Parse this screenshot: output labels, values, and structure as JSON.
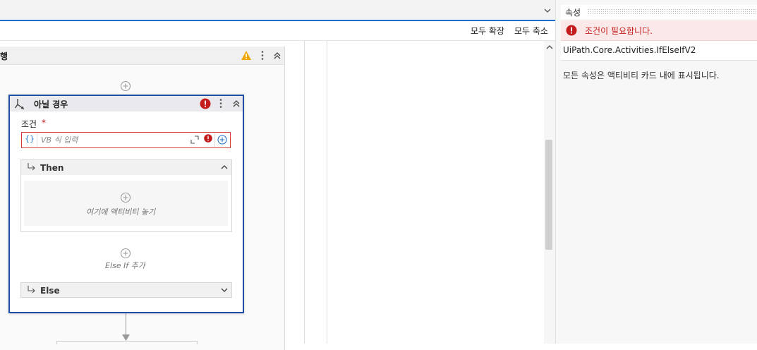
{
  "toolbar": {
    "expand_all": "모두 확장",
    "collapse_all": "모두 축소"
  },
  "outer_sequence": {
    "title": "행"
  },
  "card": {
    "title": "아닐 경우",
    "condition_label": "조건",
    "required_mark": "*",
    "condition_brace": "{}",
    "condition_placeholder": "VB 식 입력",
    "then_label": "Then",
    "drop_hint": "여기에 액티비티 놓기",
    "add_else_if": "Else If 추가",
    "else_label": "Else"
  },
  "properties": {
    "title": "속성",
    "error_message": "조건이 필요합니다.",
    "activity_type": "UiPath.Core.Activities.IfElseIfV2",
    "info": "모든 속성은 액티비티 카드 내에 표시됩니다."
  },
  "colors": {
    "accent": "#1e6fc8",
    "card_border": "#1e4fa3",
    "error": "#c41c1c",
    "warning": "#f0a500"
  },
  "icons": [
    "chevron-down-icon",
    "warning-icon",
    "more-icon",
    "collapse-icon",
    "add-icon",
    "branch-icon",
    "error-icon",
    "expand-field-icon",
    "add-circle-icon",
    "chevron-up-icon",
    "arrow-down-icon"
  ]
}
